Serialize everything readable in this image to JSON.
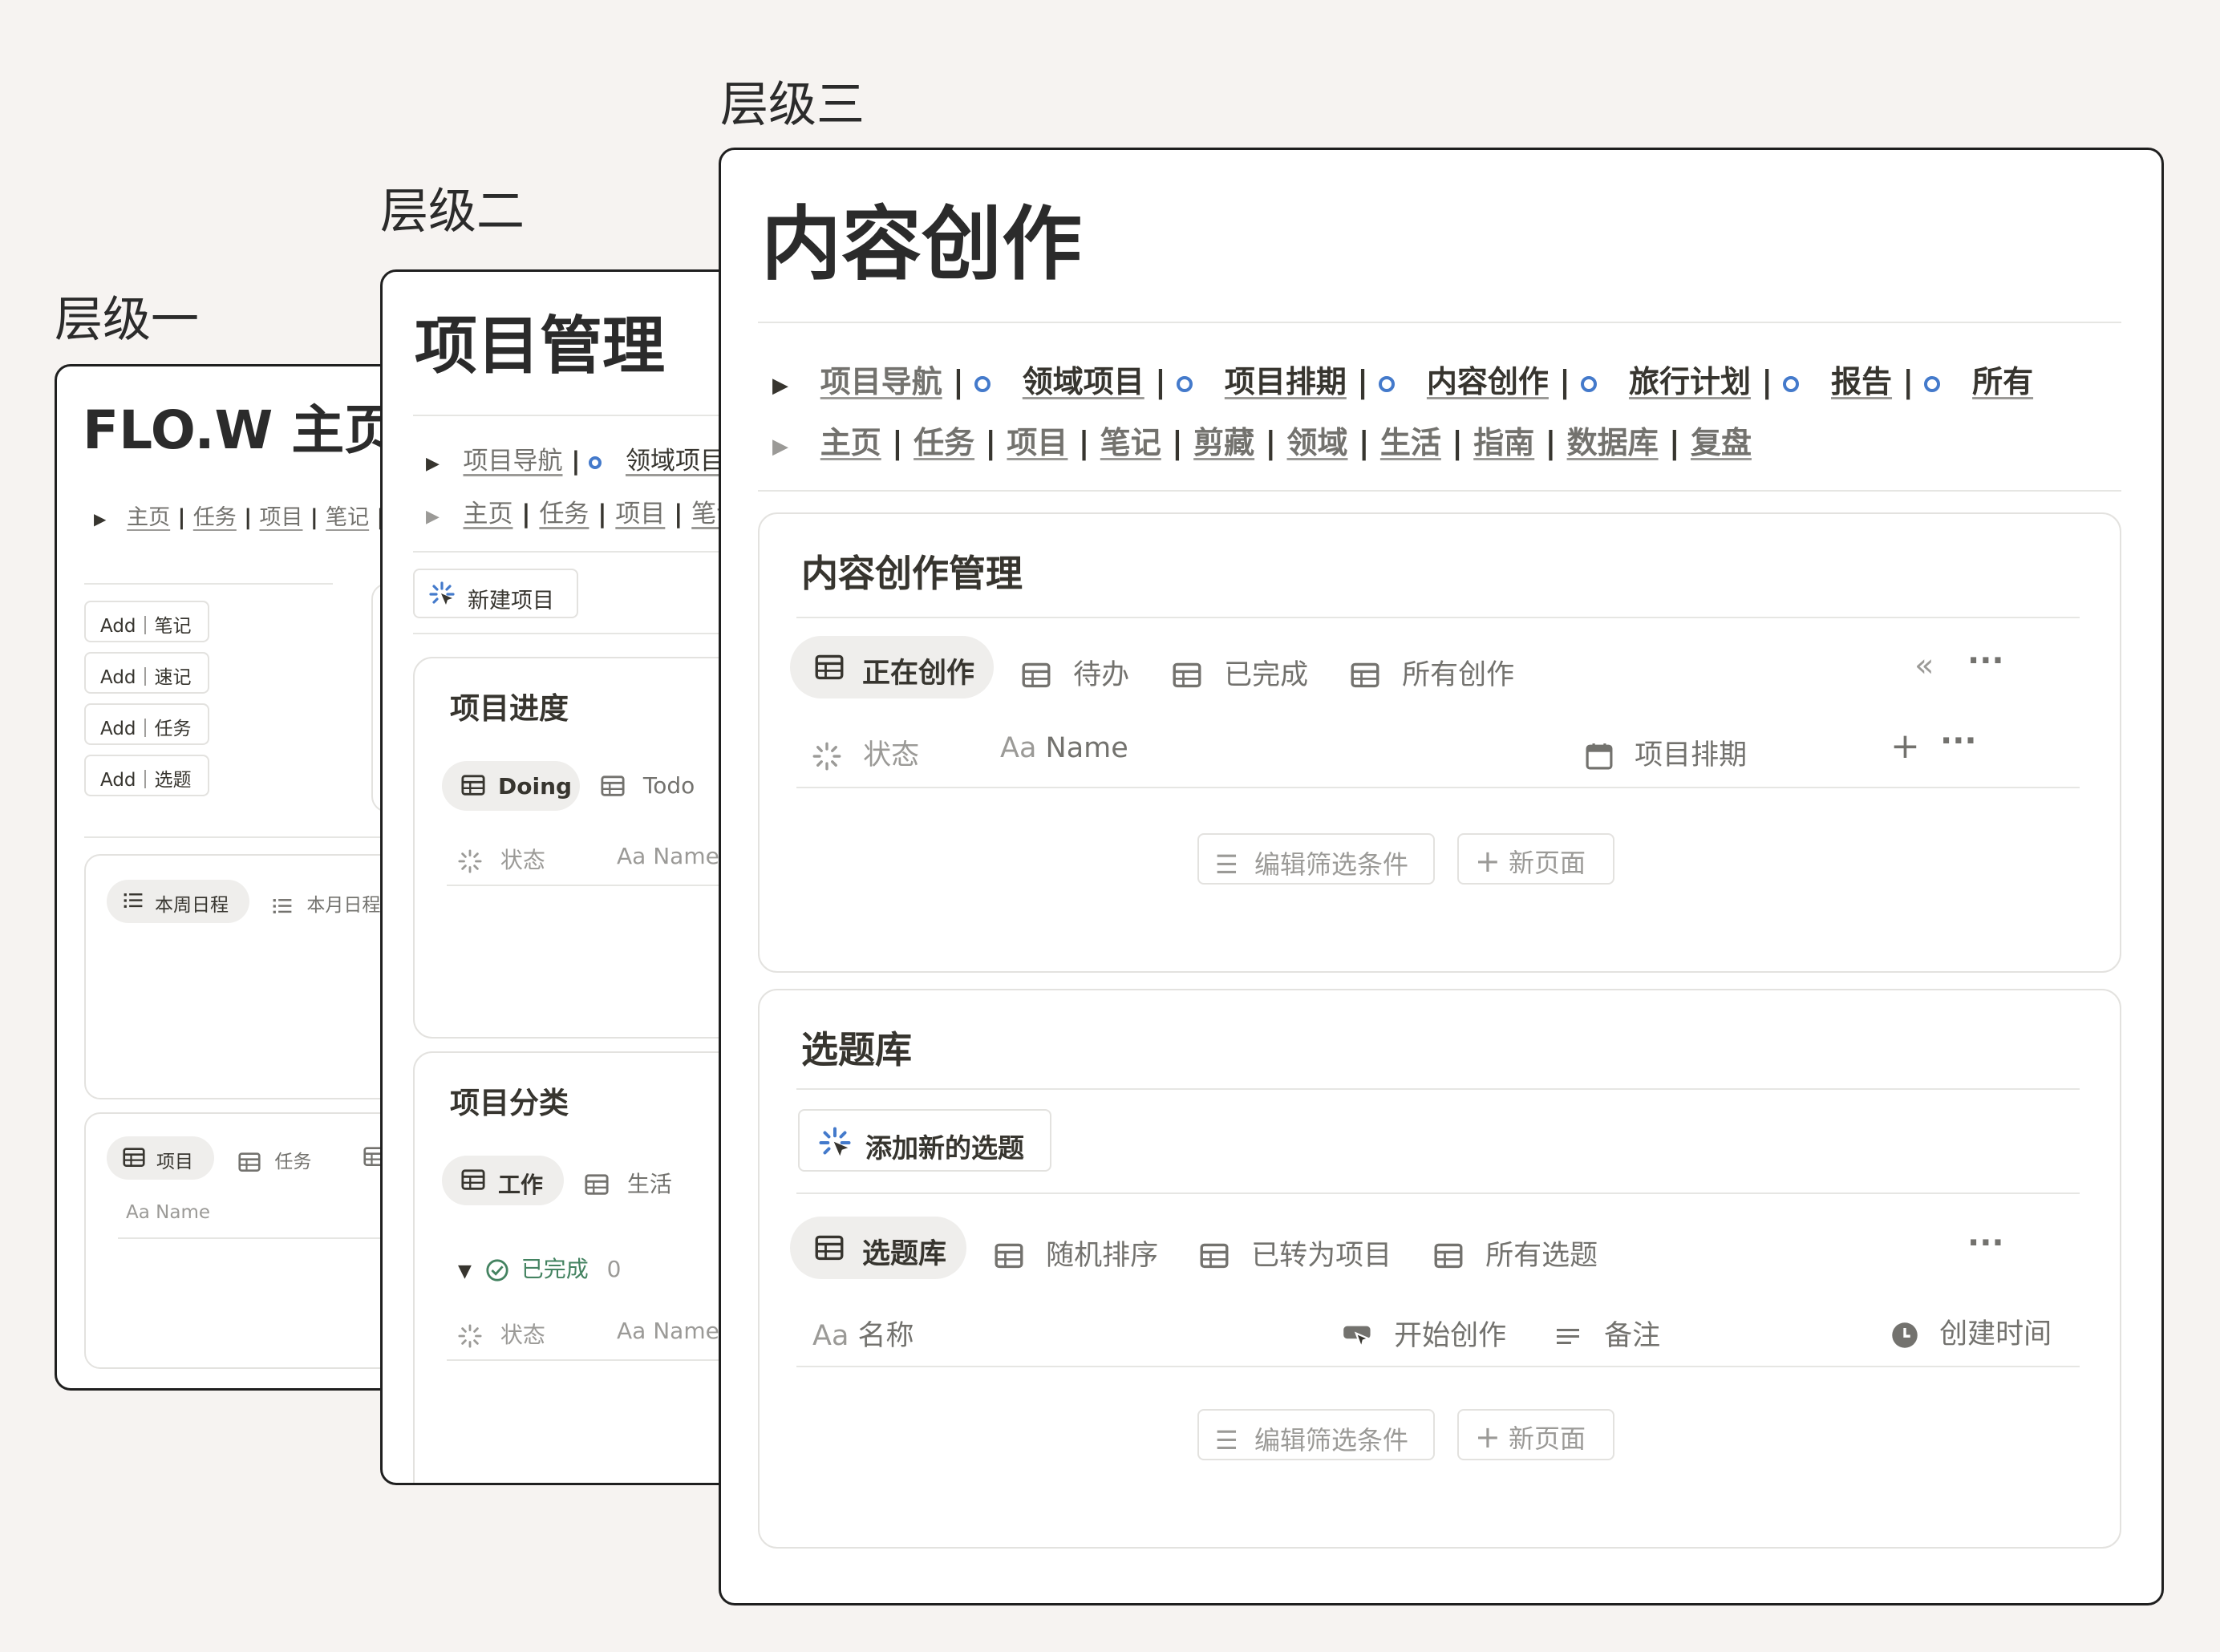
{
  "levels": {
    "one": "层级一",
    "two": "层级二",
    "three": "层级三"
  },
  "home": {
    "title": "FLO.W 主页",
    "nav": [
      "主页",
      "任务",
      "项目",
      "笔记"
    ],
    "add_buttons": [
      "Add｜笔记",
      "Add｜速记",
      "Add｜任务",
      "Add｜选题"
    ],
    "schedule_tabs": [
      "本周日程",
      "本月日程"
    ],
    "db_tabs": [
      "项目",
      "任务"
    ],
    "name_col": "Name"
  },
  "project": {
    "title": "项目管理",
    "nav1_first": "项目导航",
    "nav1_second": "领域项目",
    "nav2": [
      "主页",
      "任务",
      "项目",
      "笔记"
    ],
    "new_button": "新建项目",
    "progress": {
      "title": "项目进度",
      "tabs": [
        "Doing",
        "Todo"
      ],
      "col_status": "状态",
      "col_name": "Name"
    },
    "category": {
      "title": "项目分类",
      "tabs": [
        "工作",
        "生活"
      ],
      "group": "已完成",
      "group_count": "0",
      "col_status": "状态",
      "col_name": "Name"
    }
  },
  "content": {
    "title": "内容创作",
    "nav1": [
      "项目导航",
      "领域项目",
      "项目排期",
      "内容创作",
      "旅行计划",
      "报告",
      "所有"
    ],
    "nav2": [
      "主页",
      "任务",
      "项目",
      "笔记",
      "剪藏",
      "领域",
      "生活",
      "指南",
      "数据库",
      "复盘"
    ],
    "mgmt": {
      "title": "内容创作管理",
      "tabs": [
        "正在创作",
        "待办",
        "已完成",
        "所有创作"
      ],
      "col_status": "状态",
      "col_name": "Name",
      "col_schedule": "项目排期",
      "filter_btn": "编辑筛选条件",
      "new_page": "新页面"
    },
    "topics": {
      "title": "选题库",
      "add_btn": "添加新的选题",
      "tabs": [
        "选题库",
        "随机排序",
        "已转为项目",
        "所有选题"
      ],
      "col_name": "名称",
      "col_start": "开始创作",
      "col_note": "备注",
      "col_created": "创建时间",
      "filter_btn": "编辑筛选条件",
      "new_page": "新页面"
    }
  },
  "icons": {
    "table": "table-icon",
    "list": "list-icon",
    "status": "status-icon",
    "text": "text-property-icon",
    "calendar": "calendar-icon",
    "clock": "clock-icon",
    "cursor": "cursor-click-icon",
    "plus": "plus-icon",
    "more": "more-icon",
    "filter": "filter-icon",
    "collapse": "double-chevron-left-icon",
    "toggle": "triangle-icon",
    "check": "check-circle-icon",
    "sparkle": "sparkle-icon"
  },
  "colors": {
    "background": "#f6f3f1",
    "text": "#37352f",
    "gray": "#9b9a97",
    "accent": "#447acb",
    "done_green": "#448361"
  }
}
